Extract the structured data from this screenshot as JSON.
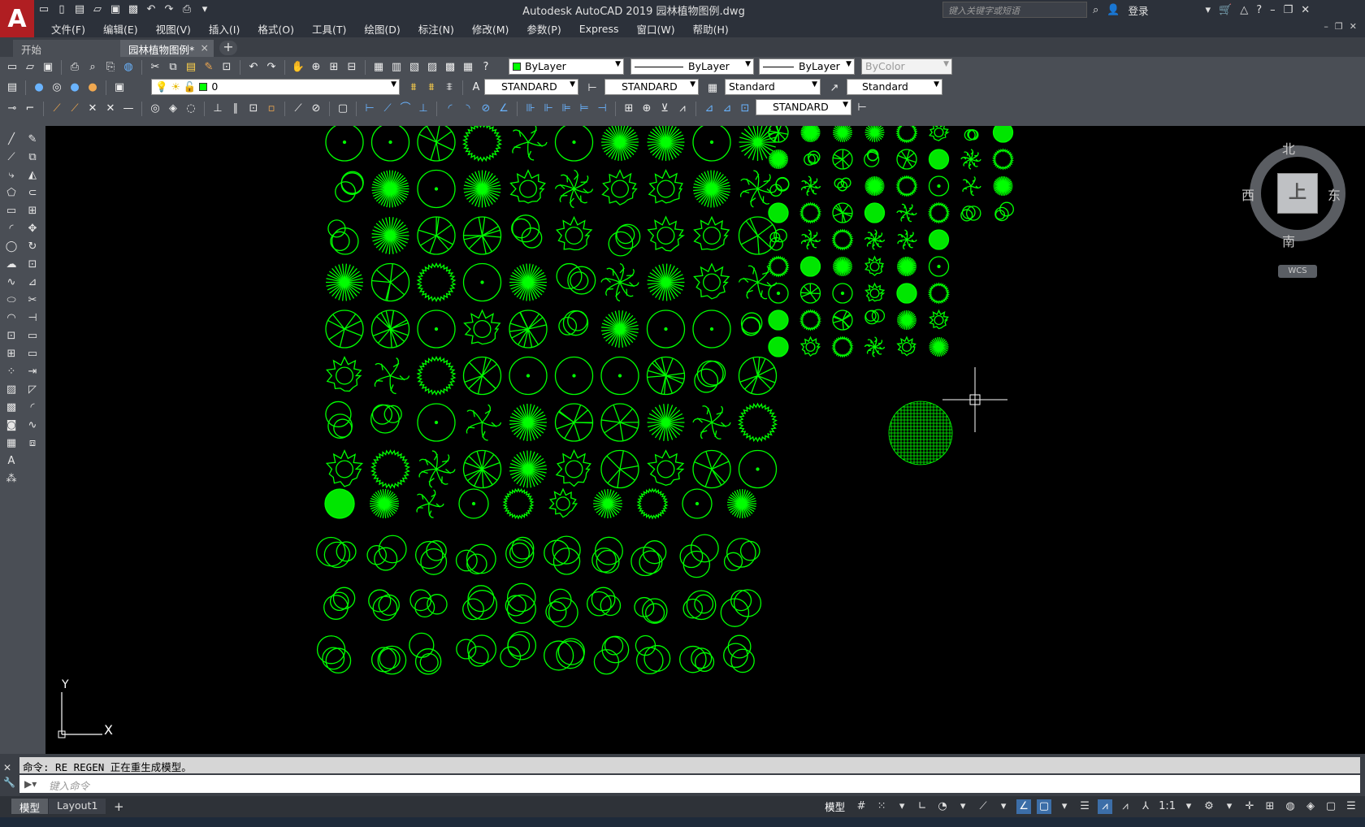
{
  "app": {
    "logo_letter": "A",
    "title": "Autodesk AutoCAD 2019    园林植物图例.dwg",
    "search_placeholder": "键入关键字或短语",
    "login_label": "登录"
  },
  "menu": [
    "文件(F)",
    "编辑(E)",
    "视图(V)",
    "插入(I)",
    "格式(O)",
    "工具(T)",
    "绘图(D)",
    "标注(N)",
    "修改(M)",
    "参数(P)",
    "Express",
    "窗口(W)",
    "帮助(H)"
  ],
  "tabs": {
    "start": "开始",
    "doc": "园林植物图例*",
    "close": "×",
    "add": "+"
  },
  "properties": {
    "color": "ByLayer",
    "linetype": "ByLayer",
    "lineweight": "ByLayer",
    "plotstyle": "ByColor",
    "layer": "0",
    "text_style": "STANDARD",
    "dim_style": "STANDARD",
    "table_style": "Standard",
    "mleader_style": "Standard",
    "dim_style_2": "STANDARD"
  },
  "viewcube": {
    "north": "北",
    "south": "南",
    "west": "西",
    "east": "东",
    "face": "上",
    "wcs": "WCS"
  },
  "ucs": {
    "x": "X",
    "y": "Y"
  },
  "command": {
    "history": "命令: RE REGEN 正在重生成模型。",
    "placeholder": "键入命令"
  },
  "status": {
    "model_tab": "模型",
    "layout1_tab": "Layout1",
    "add": "+",
    "model_space": "模型",
    "scale": "1:1"
  },
  "colors": {
    "plant": "#00ff00",
    "canvas": "#000000",
    "ui_dark": "#2c313a",
    "ui_mid": "#4a4e55"
  }
}
